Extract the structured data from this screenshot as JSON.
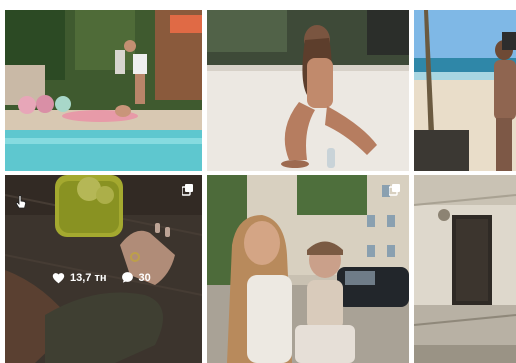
{
  "posts": [
    {
      "name": "post-pool",
      "type": "photo"
    },
    {
      "name": "post-beach-sit",
      "type": "photo"
    },
    {
      "name": "post-beach-walk",
      "type": "photo"
    },
    {
      "name": "post-drink-hand",
      "type": "carousel",
      "hovered": true,
      "likes_label": "13,7 тн",
      "comments_label": "30"
    },
    {
      "name": "post-street-baby",
      "type": "carousel"
    },
    {
      "name": "post-building",
      "type": "photo"
    }
  ],
  "icons": {
    "like": "heart-icon",
    "comment": "comment-bubble-icon",
    "carousel": "carousel-icon",
    "cursor": "hand-cursor-icon"
  },
  "colors": {
    "overlay_text": "#ffffff",
    "pool_water": "#5ec7cf",
    "sand": "#ece8e2",
    "sky": "#7fb8e6"
  }
}
